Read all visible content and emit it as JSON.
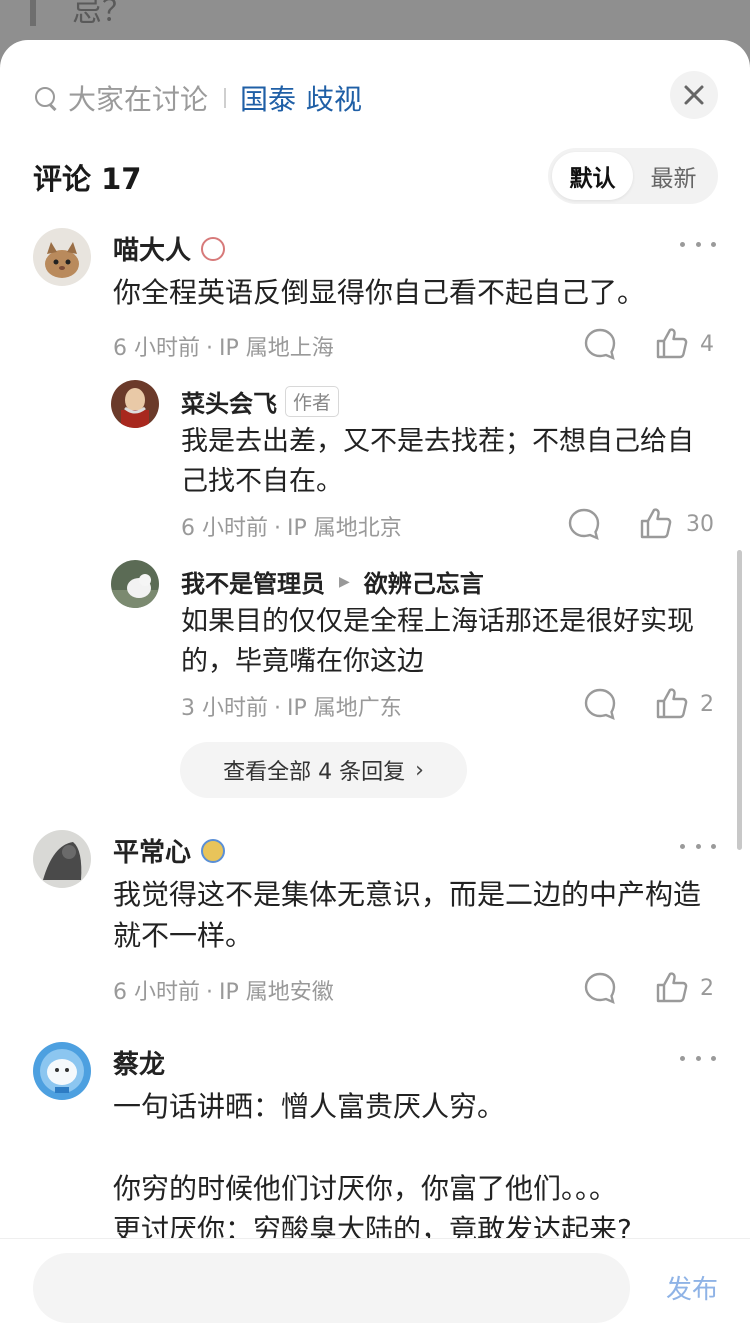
{
  "background": {
    "text": "忌？"
  },
  "header": {
    "search_label": "大家在讨论",
    "hot_tags": [
      "国泰",
      "歧视"
    ]
  },
  "comments_header": {
    "title": "评论 17",
    "sort_options": [
      "默认",
      "最新"
    ],
    "active_sort": "默认"
  },
  "comments": [
    {
      "user": "喵大人",
      "text": "你全程英语反倒显得你自己看不起自己了。",
      "time": "6 小时前",
      "location": "IP 属地上海",
      "likes": "4",
      "replies": [
        {
          "user": "菜头会飞",
          "tag": "作者",
          "text": "我是去出差，又不是去找茬；不想自己给自己找不自在。",
          "time": "6 小时前",
          "location": "IP 属地北京",
          "likes": "30"
        },
        {
          "user": "我不是管理员",
          "reply_to": "欲辨己忘言",
          "text": "如果目的仅仅是全程上海话那还是很好实现的，毕竟嘴在你这边",
          "time": "3 小时前",
          "location": "IP 属地广东",
          "likes": "2"
        }
      ],
      "see_all_label": "查看全部 4 条回复"
    },
    {
      "user": "平常心",
      "text": "我觉得这不是集体无意识，而是二边的中产构造就不一样。",
      "time": "6 小时前",
      "location": "IP 属地安徽",
      "likes": "2"
    },
    {
      "user": "蔡龙",
      "text_lines": [
        "一句话讲晒：憎人富贵厌人穷。",
        "",
        "你穷的时候他们讨厌你，你富了他们。。。",
        "更讨厌你：穷酸臭大陆的，竟敢发达起来?"
      ]
    }
  ],
  "bottom_bar": {
    "input_placeholder": "",
    "publish_label": "发布"
  },
  "colors": {
    "link_blue": "#1f5fa6",
    "publish_blue": "#8fb3e6",
    "meta_gray": "#999999"
  },
  "icons": [
    "search-icon",
    "close-icon",
    "more-icon",
    "reply-icon",
    "like-icon",
    "chevron-right-icon"
  ]
}
